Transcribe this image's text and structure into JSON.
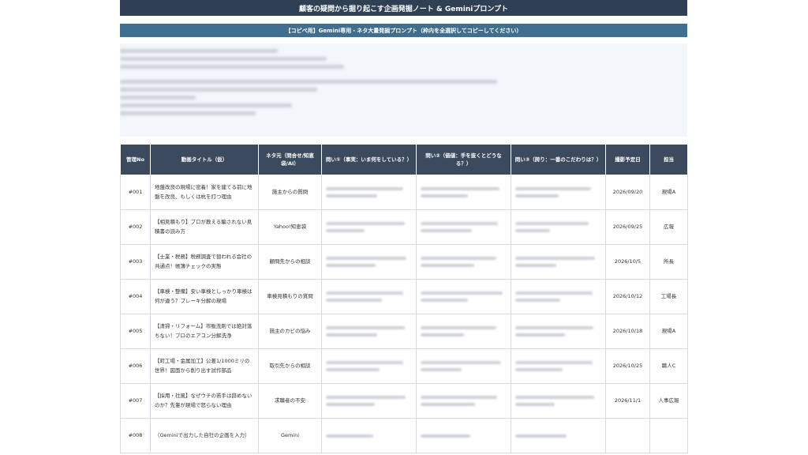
{
  "header": {
    "title": "顧客の疑問から掘り起こす企画発掘ノート & Geminiプロンプト"
  },
  "prompt_section": {
    "title": "【コピペ用】Gemini専用・ネタ大量発掘プロンプト（枠内を全選択してコピーしてください）"
  },
  "table": {
    "columns": [
      "管理No",
      "動画タイトル（仮）",
      "ネタ元（問合せ/知恵袋/AI）",
      "問い①（事実：いま何をしている？）",
      "問い②（価値：手を抜くとどうなる？）",
      "問い③（誇り：一番のこだわりは？）",
      "撮影予定日",
      "担当"
    ],
    "rows": [
      {
        "no": "#001",
        "title": "地盤改良の現場に密着！家を建てる前に地盤を改良、もしくは杭を打つ理由",
        "source": "施主からの質問",
        "date": "2026/09/20",
        "owner": "現場A"
      },
      {
        "no": "#002",
        "title": "【相見積もり】プロが教える騙されない見積書の読み方",
        "source": "Yahoo!知恵袋",
        "date": "2026/09/25",
        "owner": "広報"
      },
      {
        "no": "#003",
        "title": "【士業・税務】税務調査で狙われる会社の共通点！帳簿チェックの実態",
        "source": "顧問先からの相談",
        "date": "2026/10/5",
        "owner": "所長"
      },
      {
        "no": "#004",
        "title": "【車検・整備】安い車検としっかり車検は何が違う？ブレーキ分解の現場",
        "source": "車検見積もりの質問",
        "date": "2026/10/12",
        "owner": "工場長"
      },
      {
        "no": "#005",
        "title": "【清掃・リフォーム】市販洗剤では絶対落ちない！プロのエアコン分解洗浄",
        "source": "施主のカビの悩み",
        "date": "2026/10/18",
        "owner": "現場A"
      },
      {
        "no": "#006",
        "title": "【町工場・金属加工】公差1/1000ミリの世界！図面から削り出す試作部品",
        "source": "取引先からの相談",
        "date": "2026/10/25",
        "owner": "職人C"
      },
      {
        "no": "#007",
        "title": "【採用・社風】なぜウチの若手は辞めないのか？先輩が現場で怒らない理由",
        "source": "求職者の不安",
        "date": "2026/11/1",
        "owner": "人事広報"
      },
      {
        "no": "#008",
        "title": "（Geminiで出力した自社の企画を入力）",
        "source": "Gemini",
        "date": "",
        "owner": ""
      }
    ]
  }
}
